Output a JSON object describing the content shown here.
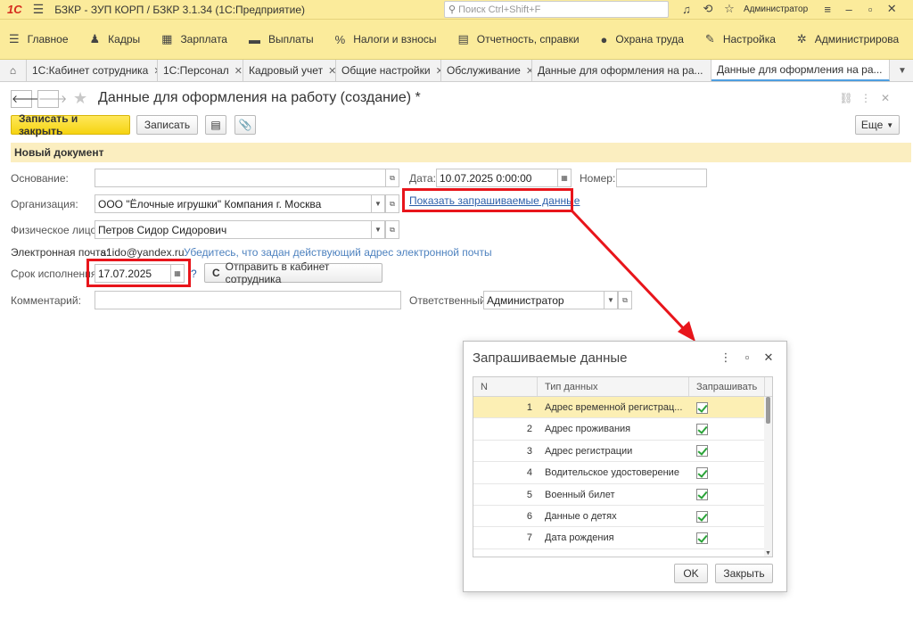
{
  "titlebar": {
    "logo": "1С",
    "title": "БЗКР - ЗУП КОРП / БЗКР 3.1.34  (1С:Предприятие)",
    "search_placeholder": "Поиск Ctrl+Shift+F",
    "user": "Администратор"
  },
  "menu": {
    "items": [
      {
        "label": "Главное",
        "icon": "burger-icon"
      },
      {
        "label": "Кадры",
        "icon": "people-icon"
      },
      {
        "label": "Зарплата",
        "icon": "calculator-icon"
      },
      {
        "label": "Выплаты",
        "icon": "wallet-icon"
      },
      {
        "label": "Налоги и взносы",
        "icon": "percent-icon"
      },
      {
        "label": "Отчетность, справки",
        "icon": "report-icon"
      },
      {
        "label": "Охрана труда",
        "icon": "helmet-icon"
      },
      {
        "label": "Настройка",
        "icon": "wrench-icon"
      },
      {
        "label": "Администрирова",
        "icon": "gear-icon"
      }
    ]
  },
  "tabs": [
    {
      "label": "1С:Кабинет сотрудника"
    },
    {
      "label": "1С:Персонал"
    },
    {
      "label": "Кадровый учет"
    },
    {
      "label": "Общие настройки"
    },
    {
      "label": "Обслуживание"
    },
    {
      "label": "Данные для оформления на ра..."
    },
    {
      "label": "Данные для оформления на ра..."
    }
  ],
  "form": {
    "title": "Данные для оформления на работу (создание) *",
    "save_close": "Записать и закрыть",
    "save": "Записать",
    "more": "Еще",
    "section": "Новый документ",
    "basis_label": "Основание:",
    "basis_value": "",
    "date_label": "Дата:",
    "date_value": "10.07.2025  0:00:00",
    "number_label": "Номер:",
    "number_value": "",
    "org_label": "Организация:",
    "org_value": "ООО \"Ёлочные игрушки\" Компания г. Москва",
    "show_link": "Показать запрашиваемые данные",
    "person_label": "Физическое лицо:",
    "person_value": "Петров Сидор Сидорович",
    "email_label": "Электронная почта:",
    "email_value": "s1ido@yandex.ru",
    "email_hint": "Убедитесь, что задан действующий адрес электронной почты",
    "deadline_label": "Срок исполнения:",
    "deadline_value": "17.07.2025",
    "question": "?",
    "send_button": "Отправить в кабинет сотрудника",
    "comment_label": "Комментарий:",
    "comment_value": "",
    "resp_label": "Ответственный:",
    "resp_value": "Администратор"
  },
  "dialog": {
    "title": "Запрашиваемые данные",
    "columns": [
      "N",
      "Тип данных",
      "Запрашивать"
    ],
    "rows": [
      {
        "n": "1",
        "type": "Адрес временной регистрац...",
        "checked": true
      },
      {
        "n": "2",
        "type": "Адрес проживания",
        "checked": true
      },
      {
        "n": "3",
        "type": "Адрес регистрации",
        "checked": true
      },
      {
        "n": "4",
        "type": "Водительское удостоверение",
        "checked": true
      },
      {
        "n": "5",
        "type": "Военный билет",
        "checked": true
      },
      {
        "n": "6",
        "type": "Данные о детях",
        "checked": true
      },
      {
        "n": "7",
        "type": "Дата рождения",
        "checked": true
      }
    ],
    "ok": "OK",
    "close": "Закрыть"
  },
  "colors": {
    "accent": "#fbeb9b",
    "highlight": "#e8151b",
    "link": "#2b5ea9"
  }
}
